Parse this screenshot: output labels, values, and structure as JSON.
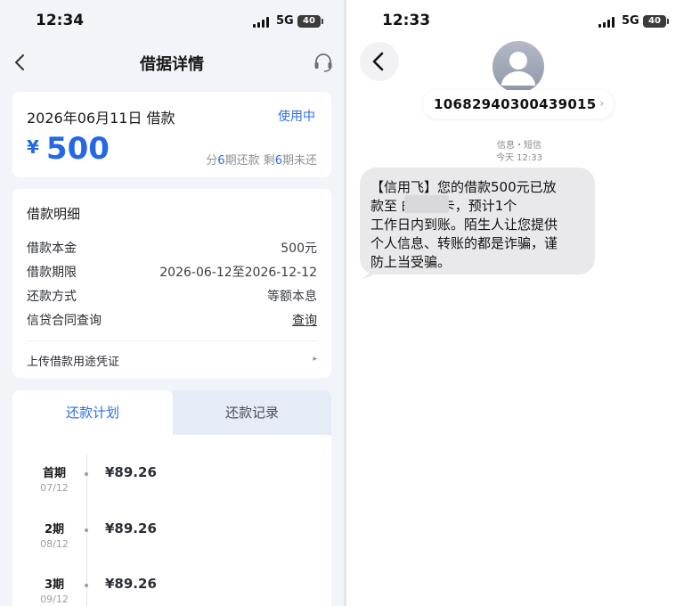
{
  "left_phone": {
    "status": {
      "time": "12:34",
      "network": "5G",
      "battery": "40"
    },
    "nav": {
      "title": "借据详情"
    },
    "loan_card": {
      "date_label": "2026年06月11日 借款",
      "status": "使用中",
      "currency": "¥",
      "amount": "500",
      "plan_prefix": "分",
      "plan_total": "6",
      "plan_mid": "期还款 剩",
      "plan_remaining": "6",
      "plan_suffix": "期未还"
    },
    "details": {
      "heading": "借款明细",
      "rows": [
        {
          "label": "借款本金",
          "value": "500元"
        },
        {
          "label": "借款期限",
          "value": "2026-06-12至2026-12-12"
        },
        {
          "label": "还款方式",
          "value": "等额本息"
        },
        {
          "label": "信贷合同查询",
          "value": "查询"
        }
      ],
      "upload_label": "上传借款用途凭证",
      "upload_chevron": "▸"
    },
    "tabs": [
      {
        "label": "还款计划",
        "active": true
      },
      {
        "label": "还款记录",
        "active": false
      }
    ],
    "plan": [
      {
        "name": "首期",
        "date": "07/12",
        "amount": "¥89.26"
      },
      {
        "name": "2期",
        "date": "08/12",
        "amount": "¥89.26"
      },
      {
        "name": "3期",
        "date": "09/12",
        "amount": "¥89.26"
      }
    ]
  },
  "right_phone": {
    "status": {
      "time": "12:33",
      "network": "5G",
      "battery": "40"
    },
    "sender": "1068294030043901​5",
    "sender_chevron": "›",
    "meta_line1": "信息・短信",
    "meta_line2": "今天 12:33",
    "message": "【信用飞】您的借款500元已放\n款至        的银行卡，预计1个\n工作日内到账。陌生人让您提供\n个人信息、转账的都是诈骗，谨\n防上当受骗。"
  },
  "colors": {
    "accent": "#2b6fe0",
    "amount": "#2469e3",
    "bubble": "#e9e9eb",
    "page_bg": "#f1f4f9"
  },
  "icons": [
    "back-chevron-icon",
    "headset-icon",
    "signal-icon",
    "battery-icon",
    "contact-avatar-icon"
  ]
}
